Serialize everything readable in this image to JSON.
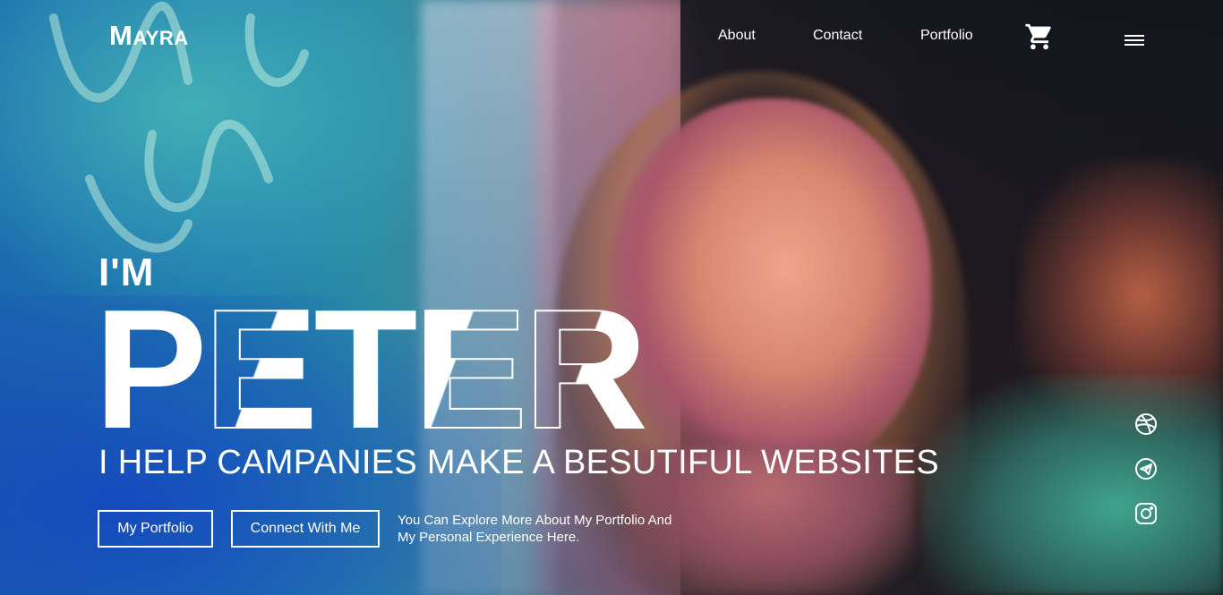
{
  "header": {
    "logo": "Mayra",
    "nav": [
      {
        "label": "About"
      },
      {
        "label": "Contact"
      },
      {
        "label": "Portfolio"
      }
    ],
    "icons": [
      "cart-icon",
      "hamburger-menu-icon"
    ]
  },
  "hero": {
    "intro": "I'M",
    "name": "PETER",
    "tagline": "I HELP CAMPANIES MAKE A BESUTIFUL WEBSITES",
    "buttons": {
      "portfolio": "My Portfolio",
      "connect": "Connect With Me"
    },
    "description_line1": "You Can Explore More About My Portfolio And",
    "description_line2": "My Personal Experience Here."
  },
  "socials": [
    "dribbble-icon",
    "telegram-icon",
    "instagram-icon"
  ],
  "colors": {
    "text": "#ffffff",
    "background_dark": "#10161f",
    "background_blue": "#1b6db8"
  }
}
